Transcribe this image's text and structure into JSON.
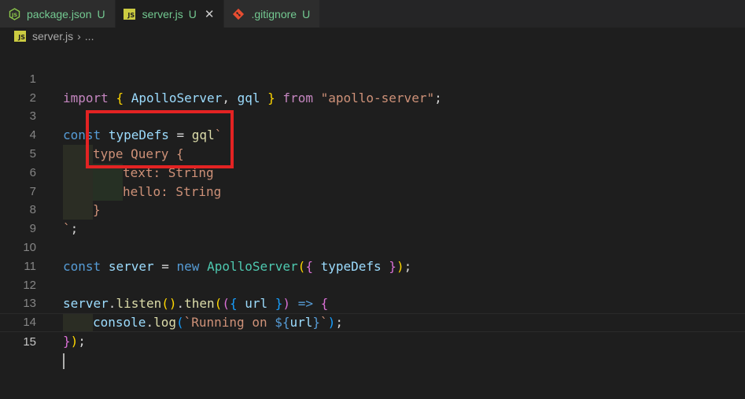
{
  "tabs": [
    {
      "label": "package.json",
      "status": "U",
      "icon": "nodejs-icon"
    },
    {
      "label": "server.js",
      "status": "U",
      "icon": "js-icon",
      "close": "✕"
    },
    {
      "label": ".gitignore",
      "status": "U",
      "icon": "git-icon"
    }
  ],
  "breadcrumb": {
    "file": "server.js",
    "separator": "›",
    "more": "..."
  },
  "js_badge": "JS",
  "line_numbers": [
    "1",
    "2",
    "3",
    "4",
    "5",
    "6",
    "7",
    "8",
    "9",
    "10",
    "11",
    "12",
    "13",
    "14",
    "15"
  ],
  "code": {
    "l1": {
      "import": "import",
      "b1": "{",
      "a": "ApolloServer",
      "comma": ",",
      "b": "gql",
      "b2": "}",
      "from": "from",
      "str": "\"apollo-server\"",
      "semi": ";"
    },
    "l3": {
      "const": "const",
      "name": "typeDefs",
      "eq": "=",
      "fn": "gql",
      "tick": "`"
    },
    "l4": "type Query {",
    "l5": "text: String",
    "l6": "hello: String",
    "l7": "}",
    "l8": {
      "tick": "`",
      "semi": ";"
    },
    "l10": {
      "const": "const",
      "name": "server",
      "eq": "=",
      "new": "new",
      "cls": "ApolloServer",
      "open": "(",
      "b1": "{",
      "arg": "typeDefs",
      "b2": "}",
      "close": ")",
      "semi": ";"
    },
    "l12": {
      "obj": "server",
      "dot1": ".",
      "listen": "listen",
      "p1": "()",
      "dot2": ".",
      "then": "then",
      "p2": "(",
      "p3": "(",
      "b1": "{",
      "arg": "url",
      "b2": "}",
      "p4": ")",
      "arrow": "=>",
      "b3": "{"
    },
    "l13": {
      "obj": "console",
      "dot": ".",
      "fn": "log",
      "p1": "(",
      "str1": "`Running on ",
      "dollar": "${",
      "var": "url",
      "end": "}",
      "str2": "`",
      "p2": ")",
      "semi": ";"
    },
    "l14": {
      "b": "}",
      "p": ")",
      "semi": ";"
    }
  },
  "annotation_color": "#e32323"
}
